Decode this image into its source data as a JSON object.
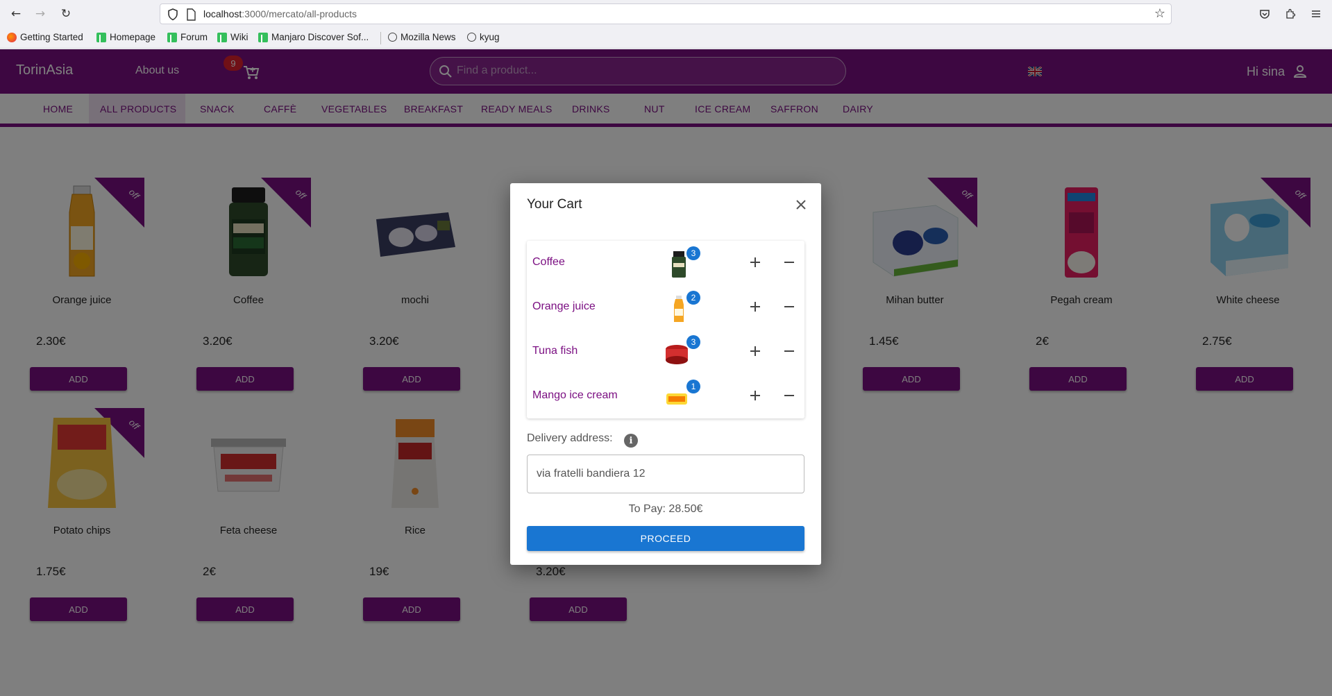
{
  "browser": {
    "url_host": "localhost",
    "url_rest": ":3000/mercato/all-products",
    "bookmarks": [
      "Getting Started",
      "Homepage",
      "Forum",
      "Wiki",
      "Manjaro Discover Sof...",
      "Mozilla News",
      "kyug"
    ]
  },
  "header": {
    "brand": "TorinAsia",
    "about": "About us",
    "cart_count": "9",
    "search_placeholder": "Find a product...",
    "greeting": "Hi sina"
  },
  "categories": [
    "HOME",
    "ALL PRODUCTS",
    "SNACK",
    "CAFFÈ",
    "VEGETABLES",
    "BREAKFAST",
    "READY MEALS",
    "DRINKS",
    "NUT",
    "ICE CREAM",
    "SAFFRON",
    "DAIRY"
  ],
  "active_category": "ALL PRODUCTS",
  "products": [
    {
      "name": "Orange juice",
      "price": "2.30€",
      "off": true
    },
    {
      "name": "Coffee",
      "price": "3.20€",
      "off": true
    },
    {
      "name": "mochi",
      "price": "3.20€",
      "off": false
    },
    {
      "name": "Mihan butter",
      "price": "1.45€",
      "off": true
    },
    {
      "name": "Pegah cream",
      "price": "2€",
      "off": false
    },
    {
      "name": "White cheese",
      "price": "2.75€",
      "off": true
    },
    {
      "name": "Potato chips",
      "price": "1.75€",
      "off": true
    },
    {
      "name": "Feta cheese",
      "price": "2€",
      "off": false
    },
    {
      "name": "Rice",
      "price": "19€",
      "off": false
    },
    {
      "name": "",
      "price": "3.20€",
      "off": false
    }
  ],
  "off_label": "off",
  "add_label": "ADD",
  "modal": {
    "title": "Your Cart",
    "items": [
      {
        "name": "Coffee",
        "qty": "3"
      },
      {
        "name": "Orange juice",
        "qty": "2"
      },
      {
        "name": "Tuna fish",
        "qty": "3"
      },
      {
        "name": "Mango ice cream",
        "qty": "1"
      }
    ],
    "address_label": "Delivery address:",
    "address_value": "via fratelli bandiera 12",
    "to_pay": "To Pay: 28.50€",
    "proceed": "PROCEED"
  },
  "colors": {
    "brand": "#7b0f82",
    "primary": "#1976d2",
    "badge": "#e0202c"
  }
}
